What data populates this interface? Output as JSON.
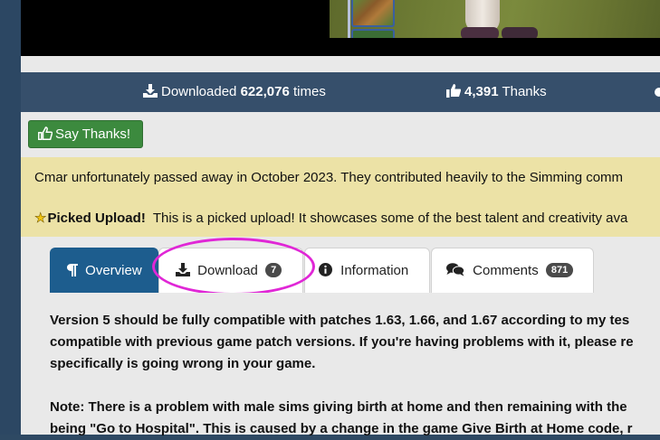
{
  "stats": {
    "downloaded_prefix": "Downloaded",
    "downloaded_count": "622,076",
    "downloaded_suffix": "times",
    "thanks_count": "4,391",
    "thanks_label": "Thanks"
  },
  "say_thanks_label": "Say Thanks!",
  "notice": {
    "memorial": "Cmar unfortunately passed away in October 2023. They contributed heavily to the Simming comm",
    "picked_label": "Picked Upload!",
    "picked_text": "This is a picked upload! It showcases some of the best talent and creativity ava"
  },
  "tabs": [
    {
      "label": "Overview"
    },
    {
      "label": "Download",
      "badge": "7"
    },
    {
      "label": "Information"
    },
    {
      "label": "Comments",
      "badge": "871"
    }
  ],
  "description": {
    "lines": [
      "Version 5 should be fully compatible with patches 1.63, 1.66, and 1.67 according to my tes",
      "compatible with previous game patch versions. If you're having problems with it, please re",
      "specifically is going wrong in your game.",
      "Note: There is a problem with male sims giving birth at home and then remaining with the",
      "being \"Go to Hospital\". This is caused by a change in the game Give Birth at Home code, r"
    ]
  },
  "colors": {
    "page_bg": "#e9e9e9",
    "stats_bar": "#364f6b",
    "thanks_button": "#3c8a3e",
    "notice_bg": "#ece2a6",
    "active_tab": "#1d5d8e",
    "annotation_ring": "#e027d6"
  },
  "icons": {
    "downloads": "download-icon",
    "thanks": "thumbs-up-icon",
    "overview": "pilcrow-icon",
    "download_tab": "download-icon",
    "information": "info-circle-icon",
    "comments": "comments-icon",
    "picked": "star-icon"
  }
}
